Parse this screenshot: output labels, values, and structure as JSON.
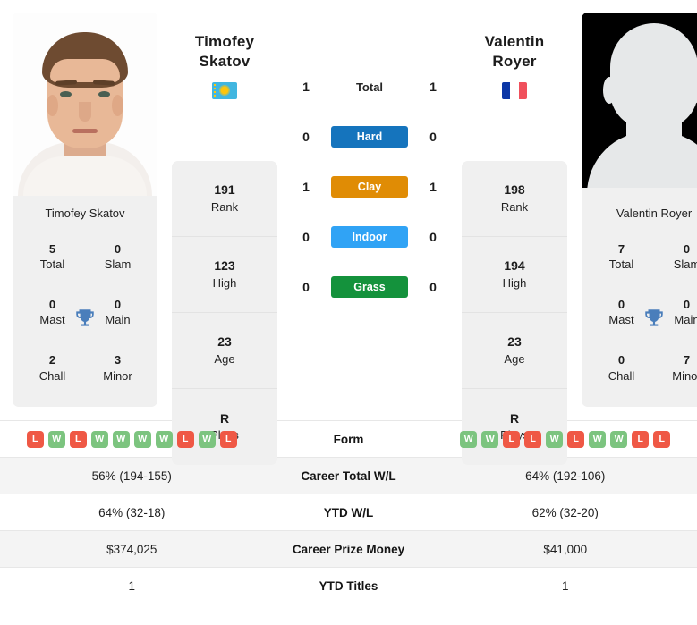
{
  "players": {
    "left": {
      "first_name": "Timofey",
      "last_name": "Skatov",
      "full_name": "Timofey Skatov",
      "country": "Kazakhstan",
      "flag_icon": "flag-kazakhstan",
      "photo": "player-photo",
      "rank": "191",
      "rank_label": "Rank",
      "high": "123",
      "high_label": "High",
      "age": "23",
      "age_label": "Age",
      "plays": "R",
      "plays_label": "Plays",
      "titles": {
        "total": "5",
        "total_label": "Total",
        "slam": "0",
        "slam_label": "Slam",
        "mast": "0",
        "mast_label": "Mast",
        "main": "0",
        "main_label": "Main",
        "chall": "2",
        "chall_label": "Chall",
        "minor": "3",
        "minor_label": "Minor"
      },
      "form": [
        "L",
        "W",
        "L",
        "W",
        "W",
        "W",
        "W",
        "L",
        "W",
        "L"
      ],
      "career_wl": "56% (194-155)",
      "ytd_wl": "64% (32-18)",
      "prize_money": "$374,025",
      "ytd_titles": "1"
    },
    "right": {
      "first_name": "Valentin",
      "last_name": "Royer",
      "full_name": "Valentin Royer",
      "country": "France",
      "flag_icon": "flag-france",
      "photo": "player-photo-placeholder",
      "rank": "198",
      "rank_label": "Rank",
      "high": "194",
      "high_label": "High",
      "age": "23",
      "age_label": "Age",
      "plays": "R",
      "plays_label": "Plays",
      "titles": {
        "total": "7",
        "total_label": "Total",
        "slam": "0",
        "slam_label": "Slam",
        "mast": "0",
        "mast_label": "Mast",
        "main": "0",
        "main_label": "Main",
        "chall": "0",
        "chall_label": "Chall",
        "minor": "7",
        "minor_label": "Minor"
      },
      "form": [
        "W",
        "W",
        "L",
        "L",
        "W",
        "L",
        "W",
        "W",
        "L",
        "L"
      ],
      "career_wl": "64% (192-106)",
      "ytd_wl": "62% (32-20)",
      "prize_money": "$41,000",
      "ytd_titles": "1"
    }
  },
  "head_to_head": {
    "total": {
      "label": "Total",
      "left": "1",
      "right": "1"
    },
    "surfaces": [
      {
        "label": "Hard",
        "color": "#1574bd",
        "left": "0",
        "right": "0"
      },
      {
        "label": "Clay",
        "color": "#e08c05",
        "left": "1",
        "right": "1"
      },
      {
        "label": "Indoor",
        "color": "#30a3f5",
        "left": "0",
        "right": "0"
      },
      {
        "label": "Grass",
        "color": "#14923c",
        "left": "0",
        "right": "0"
      }
    ]
  },
  "stats_table": {
    "rows": [
      {
        "label": "Form",
        "type": "form"
      },
      {
        "label": "Career Total W/L",
        "type": "text",
        "left": "56% (194-155)",
        "right": "64% (192-106)"
      },
      {
        "label": "YTD W/L",
        "type": "text",
        "left": "64% (32-18)",
        "right": "62% (32-20)"
      },
      {
        "label": "Career Prize Money",
        "type": "text",
        "left": "$374,025",
        "right": "$41,000"
      },
      {
        "label": "YTD Titles",
        "type": "text",
        "left": "1",
        "right": "1"
      }
    ]
  },
  "colors": {
    "win": "#7cc47f",
    "loss": "#ef5845",
    "card_bg": "#f0f0f0",
    "row_alt": "#f4f4f4",
    "trophy": "#4a7ebb"
  },
  "icons": {
    "trophy": "trophy-icon"
  }
}
